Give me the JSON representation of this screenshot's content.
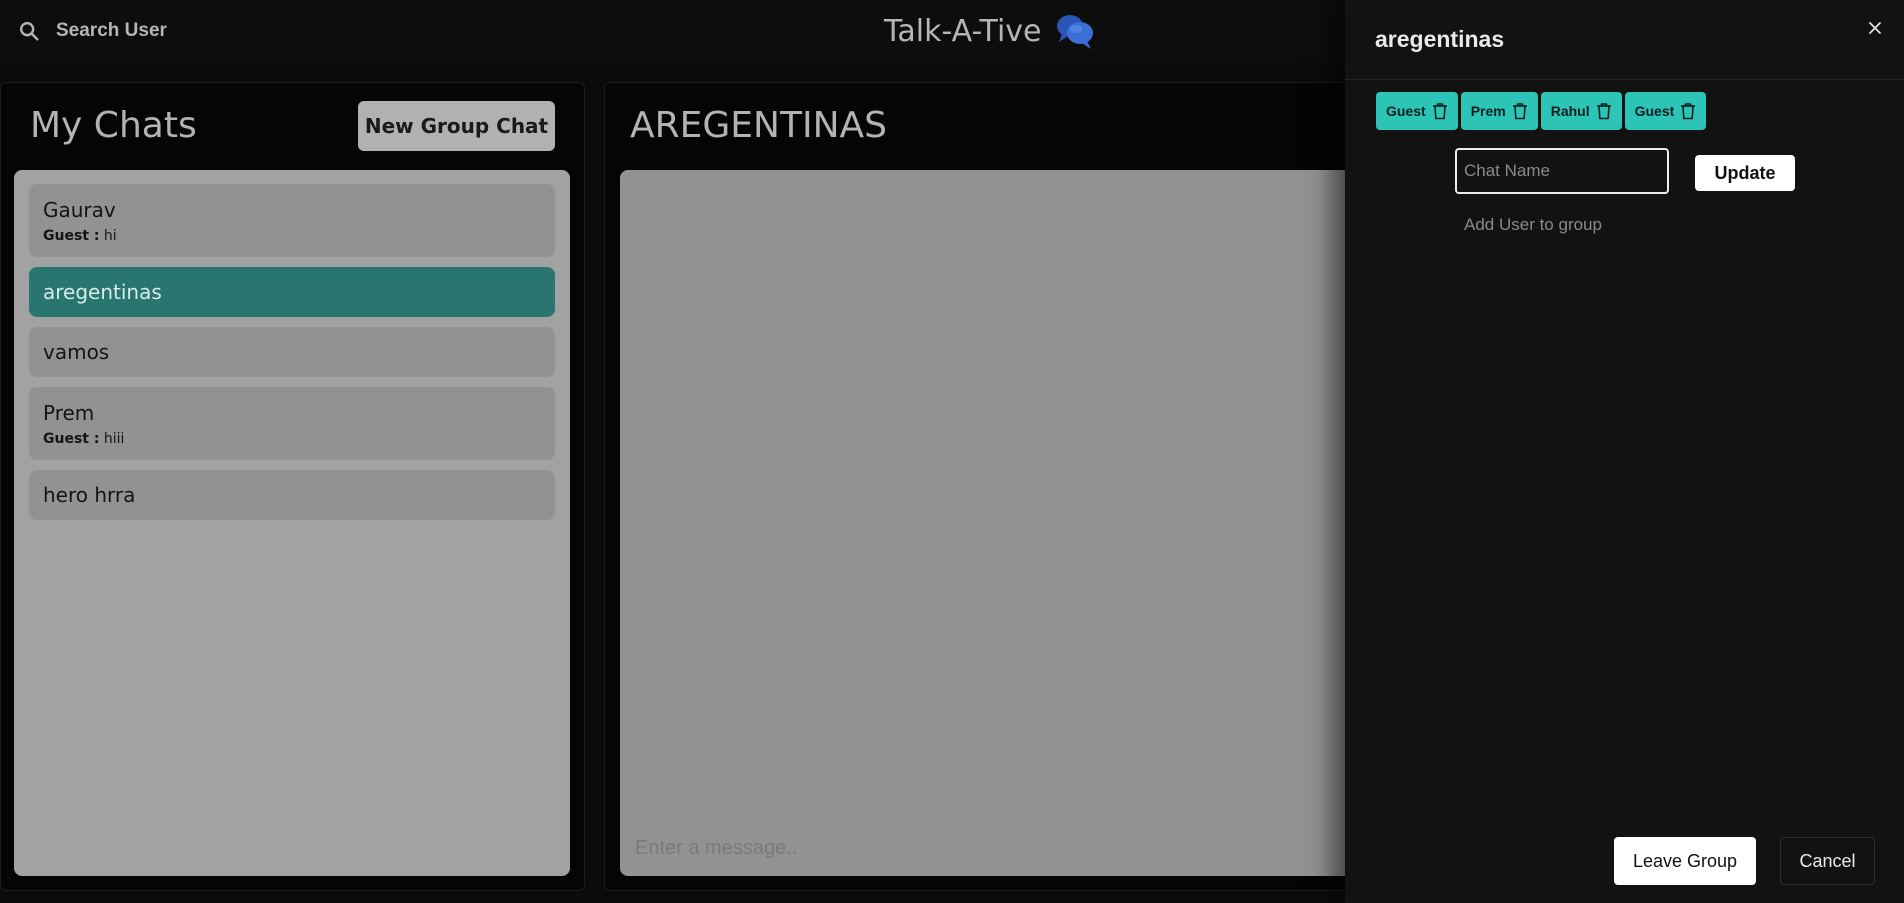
{
  "header": {
    "search_label": "Search User",
    "app_title": "Talk-A-Tive"
  },
  "sidebar": {
    "title": "My Chats",
    "new_group_label": "New Group Chat",
    "chats": [
      {
        "name": "Gaurav",
        "sender": "Guest :",
        "preview": "hi"
      },
      {
        "name": "aregentinas"
      },
      {
        "name": "vamos"
      },
      {
        "name": "Prem",
        "sender": "Guest :",
        "preview": "hiii"
      },
      {
        "name": "hero hrra"
      }
    ]
  },
  "main": {
    "chat_title": "AREGENTINAS",
    "message_placeholder": "Enter a message.."
  },
  "modal": {
    "title": "aregentinas",
    "members": [
      "Guest",
      "Prem",
      "Rahul",
      "Guest"
    ],
    "chat_name_placeholder": "Chat Name",
    "update_label": "Update",
    "add_user_placeholder": "Add User to group",
    "leave_label": "Leave Group",
    "cancel_label": "Cancel"
  },
  "colors": {
    "accent_teal": "#2bc4b7",
    "active_chat": "#28766f",
    "background": "#0b0b0b",
    "drawer": "#121212"
  }
}
